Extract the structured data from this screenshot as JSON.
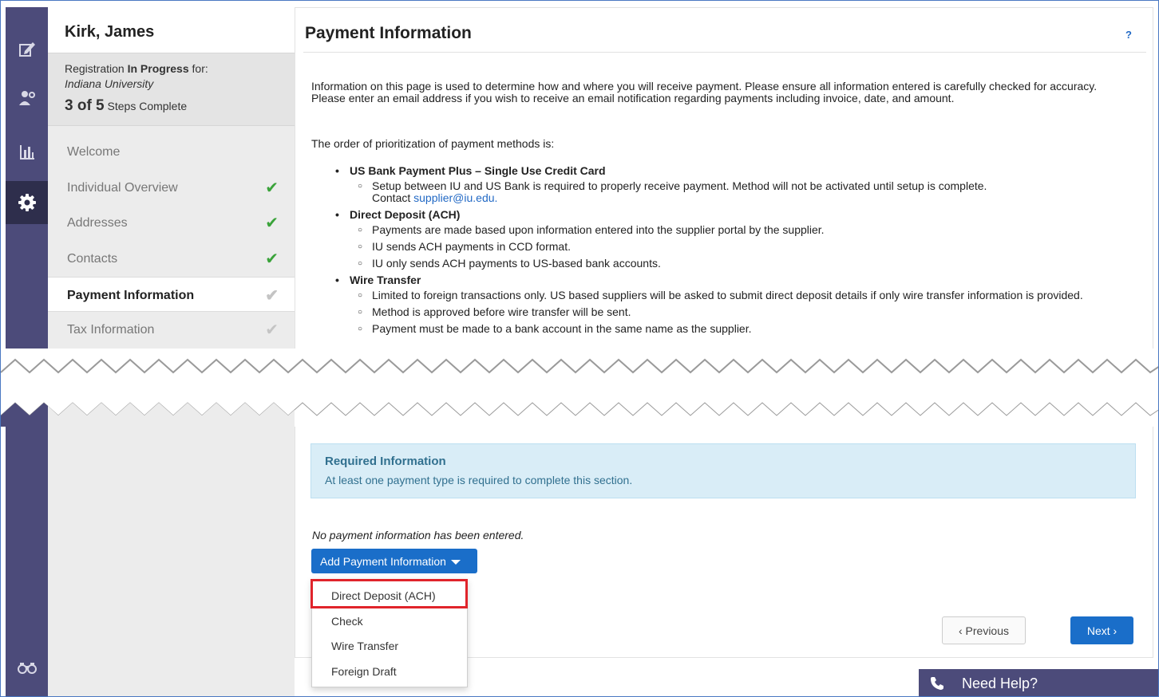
{
  "supplier": {
    "name": "Kirk, James"
  },
  "registration": {
    "status_prefix": "Registration ",
    "status_bold": "In Progress",
    "status_suffix": " for:",
    "org": "Indiana University",
    "steps_done": "3 of 5",
    "steps_text": " Steps Complete"
  },
  "steps": [
    {
      "label": "Welcome",
      "check": ""
    },
    {
      "label": "Individual Overview",
      "check": "✔"
    },
    {
      "label": "Addresses",
      "check": "✔"
    },
    {
      "label": "Contacts",
      "check": "✔"
    },
    {
      "label": "Payment Information",
      "check": "✔"
    },
    {
      "label": "Tax Information",
      "check": "✔"
    }
  ],
  "page": {
    "title": "Payment Information",
    "help": "?",
    "intro": "Information on this page is used to determine how and where you will receive payment. Please ensure all information entered is carefully checked for accuracy. Please enter an email address if you wish to receive an email notification regarding payments including invoice, date, and amount.",
    "order_text": "The order of prioritization of payment methods is:"
  },
  "methods": [
    {
      "name": "US Bank Payment Plus – Single Use Credit Card",
      "notes": [
        "Setup between IU and US Bank is required to properly receive payment. Method will not be activated until setup is complete."
      ],
      "contact_prefix": "Contact ",
      "contact_email": "supplier@iu.edu."
    },
    {
      "name": "Direct Deposit (ACH)",
      "notes": [
        "Payments are made based upon information entered into the supplier portal by the supplier.",
        "IU sends ACH payments in CCD format.",
        "IU only sends ACH payments to US-based bank accounts."
      ]
    },
    {
      "name": "Wire Transfer",
      "notes": [
        "Limited to foreign transactions only. US based suppliers will be asked to submit direct deposit details if only wire transfer information is provided.",
        "Method is approved before wire transfer will be sent.",
        "Payment must be made to a bank account in the same name as the supplier."
      ]
    }
  ],
  "required": {
    "heading": "Required Information",
    "text": "At least one payment type is required to complete this section."
  },
  "no_payment_text": "No payment information has been entered.",
  "add_button": "Add Payment Information",
  "menu_items": [
    "Direct Deposit (ACH)",
    "Check",
    "Wire Transfer",
    "Foreign Draft"
  ],
  "nav": {
    "previous": "‹ Previous",
    "next": "Next ›"
  },
  "need_help": "Need Help?",
  "colors": {
    "rail": "#4c4b7a",
    "primary": "#1a6ec9",
    "highlight": "#e0242b",
    "info_bg": "#d9edf7"
  },
  "icons": [
    "edit-icon",
    "supplier-icon",
    "bar-chart-icon",
    "gear-icon",
    "binoculars-icon",
    "phone-icon",
    "check-icon"
  ]
}
